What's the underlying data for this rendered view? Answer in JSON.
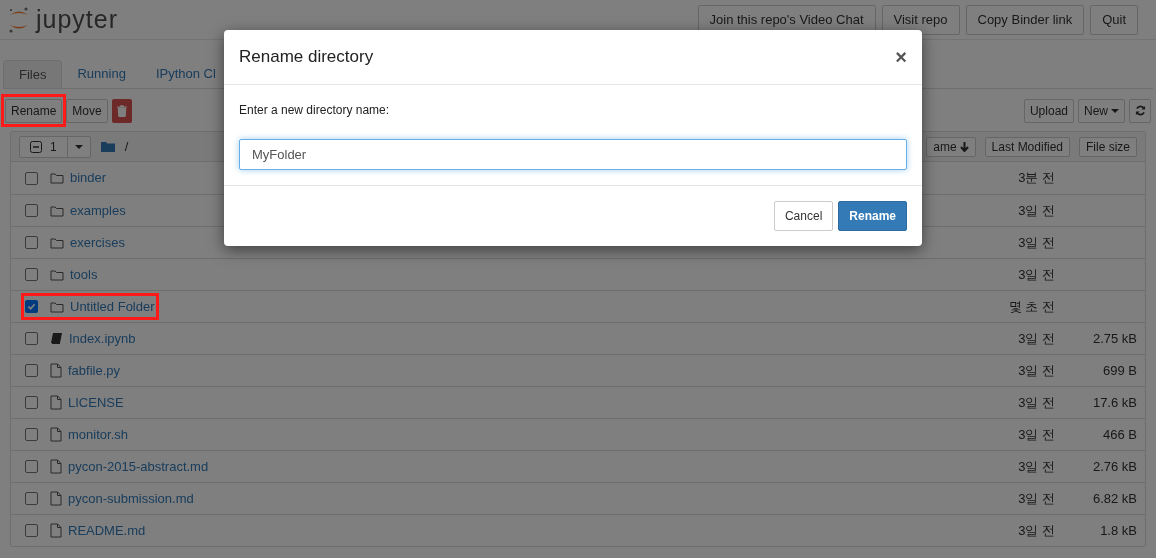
{
  "header": {
    "logo_text": "jupyter",
    "buttons": [
      "Join this repo's Video Chat",
      "Visit repo",
      "Copy Binder link",
      "Quit"
    ]
  },
  "tabs": [
    {
      "label": "Files",
      "selected": true
    },
    {
      "label": "Running",
      "selected": false
    },
    {
      "label": "IPython Cl",
      "selected": false
    }
  ],
  "toolbar": {
    "left": [
      {
        "kind": "text",
        "label": "Rename",
        "highlighted": true
      },
      {
        "kind": "text",
        "label": "Move",
        "highlighted": false
      },
      {
        "kind": "trash",
        "highlighted": false
      }
    ],
    "right": [
      {
        "kind": "text",
        "label": "Upload"
      },
      {
        "kind": "dropdown",
        "label": "New"
      },
      {
        "kind": "refresh"
      }
    ]
  },
  "list_header": {
    "selected_count": "1",
    "path": "/",
    "sort_buttons": [
      {
        "label": "ame",
        "kind": "sorted"
      },
      {
        "label": "Last Modified",
        "kind": "plain"
      },
      {
        "label": "File size",
        "kind": "plain"
      }
    ]
  },
  "rows": [
    {
      "kind": "folder",
      "name": "binder",
      "modified": "3분 전",
      "checked": false,
      "highlighted": false
    },
    {
      "kind": "folder",
      "name": "examples",
      "modified": "3일 전",
      "checked": false,
      "highlighted": false
    },
    {
      "kind": "folder",
      "name": "exercises",
      "modified": "3일 전",
      "checked": false,
      "highlighted": false
    },
    {
      "kind": "folder",
      "name": "tools",
      "modified": "3일 전",
      "checked": false,
      "highlighted": false
    },
    {
      "kind": "folder",
      "name": "Untitled Folder",
      "modified": "몇 초 전",
      "checked": true,
      "highlighted": true
    },
    {
      "kind": "notebook",
      "name": "Index.ipynb",
      "modified": "3일 전",
      "size": "2.75 kB",
      "checked": false,
      "highlighted": false
    },
    {
      "kind": "file",
      "name": "fabfile.py",
      "modified": "3일 전",
      "size": "699 B",
      "checked": false,
      "highlighted": false
    },
    {
      "kind": "file",
      "name": "LICENSE",
      "modified": "3일 전",
      "size": "17.6 kB",
      "checked": false,
      "highlighted": false
    },
    {
      "kind": "file",
      "name": "monitor.sh",
      "modified": "3일 전",
      "size": "466 B",
      "checked": false,
      "highlighted": false
    },
    {
      "kind": "file",
      "name": "pycon-2015-abstract.md",
      "modified": "3일 전",
      "size": "2.76 kB",
      "checked": false,
      "highlighted": false
    },
    {
      "kind": "file",
      "name": "pycon-submission.md",
      "modified": "3일 전",
      "size": "6.82 kB",
      "checked": false,
      "highlighted": false
    },
    {
      "kind": "file",
      "name": "README.md",
      "modified": "3일 전",
      "size": "1.8 kB",
      "checked": false,
      "highlighted": false
    }
  ],
  "dialog": {
    "title": "Rename directory",
    "close": "×",
    "prompt": "Enter a new directory name:",
    "value": "MyFolder",
    "buttons": [
      {
        "label": "Cancel",
        "kind": "default"
      },
      {
        "label": "Rename",
        "kind": "primary"
      }
    ]
  }
}
